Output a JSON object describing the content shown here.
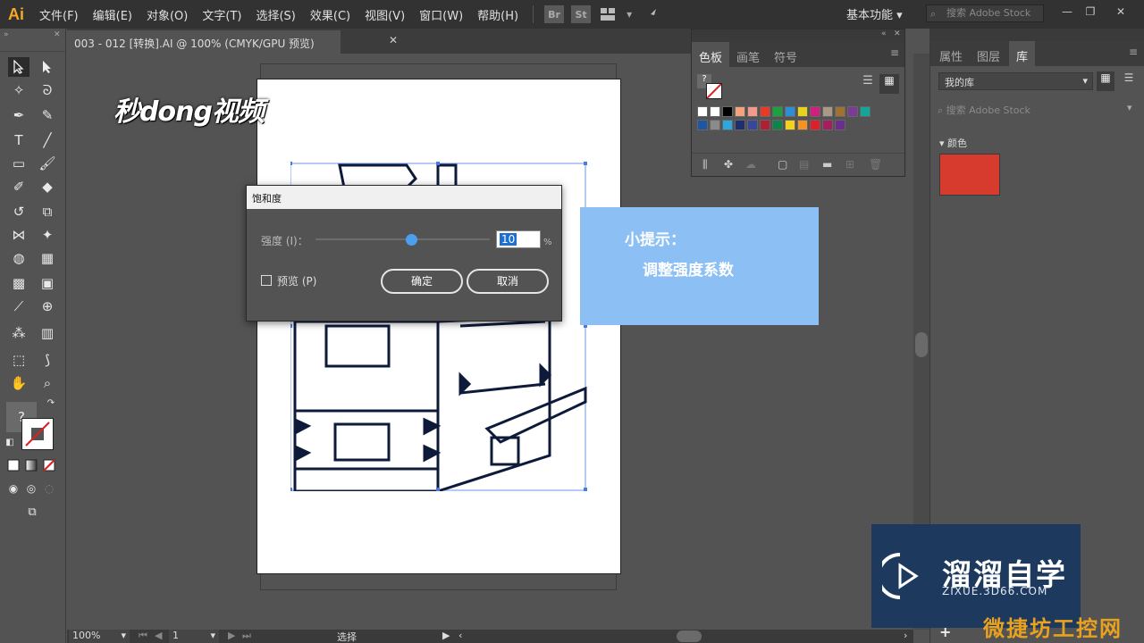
{
  "app": {
    "logo": "Ai"
  },
  "menu": [
    "文件(F)",
    "编辑(E)",
    "对象(O)",
    "文字(T)",
    "选择(S)",
    "效果(C)",
    "视图(V)",
    "窗口(W)",
    "帮助(H)"
  ],
  "menubar_icons": {
    "bridge": "Br",
    "stock": "St"
  },
  "workspace": {
    "label": "基本功能"
  },
  "stock_search": {
    "placeholder": "搜索 Adobe Stock"
  },
  "document_tab": {
    "title": "003 - 012 [转换].AI @ 100% (CMYK/GPU 预览)",
    "close": "✕"
  },
  "brand_logo": {
    "text": "秒dong视频"
  },
  "dialog": {
    "title": "饱和度",
    "intensity_label": "强度 (I)：",
    "intensity_value": "10",
    "percent": "%",
    "intensity_fraction": 0.55,
    "preview_label": "预览 (P)",
    "ok": "确定",
    "cancel": "取消"
  },
  "tip": {
    "title": "小提示：",
    "body": "调整强度系数"
  },
  "swatch_panel": {
    "tabs": [
      "色板",
      "画笔",
      "符号"
    ],
    "swatches_row1": [
      "#ffffff",
      "#ffffff",
      "#000000",
      "#f4a37c",
      "#f29b8b",
      "#e83a24",
      "#1aa23c",
      "#2a8fd6",
      "#e8d21a",
      "#d11f7d",
      "#a99a87",
      "#a1712f",
      "#7b3c96",
      "#13a59a"
    ],
    "swatches_row2": [
      "#1c57a5",
      "#8a8a8a",
      "#2ba8e0",
      "#1d2f6e",
      "#36479c",
      "#b11f35",
      "#0e8548",
      "#f4d21c",
      "#f49324",
      "#e01e26",
      "#a61e5d",
      "#6c2d8f"
    ]
  },
  "right_panel": {
    "tabs": [
      "属性",
      "图层",
      "库"
    ],
    "library": "我的库",
    "search_placeholder": "搜索 Adobe Stock",
    "section": "颜色",
    "color": "#d63b2e"
  },
  "statusbar": {
    "zoom": "100%",
    "page": "1",
    "mode": "选择"
  },
  "watermark": {
    "text": "溜溜自学",
    "sub": "ZIXUE.3D66.COM",
    "bottom": "微捷坊工控网"
  }
}
